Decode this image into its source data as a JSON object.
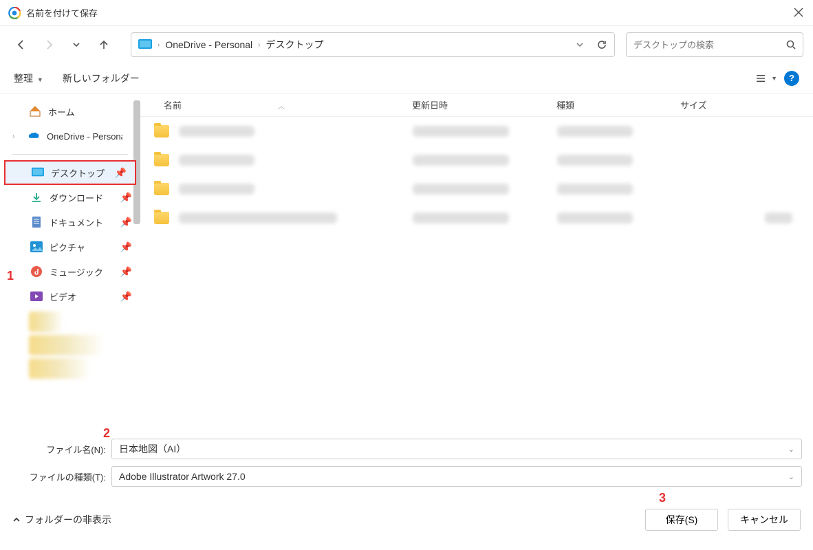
{
  "title": "名前を付けて保存",
  "breadcrumb": {
    "root": "OneDrive - Personal",
    "current": "デスクトップ"
  },
  "search": {
    "placeholder": "デスクトップの検索"
  },
  "toolbar": {
    "organize": "整理",
    "new_folder": "新しいフォルダー"
  },
  "sidebar": {
    "home": "ホーム",
    "onedrive": "OneDrive - Personal",
    "desktop": "デスクトップ",
    "downloads": "ダウンロード",
    "documents": "ドキュメント",
    "pictures": "ピクチャ",
    "music": "ミュージック",
    "videos": "ビデオ"
  },
  "columns": {
    "name": "名前",
    "date": "更新日時",
    "type": "種類",
    "size": "サイズ"
  },
  "filename": {
    "label": "ファイル名(N):",
    "value": "日本地図（AI）"
  },
  "filetype": {
    "label": "ファイルの種類(T):",
    "value": "Adobe Illustrator Artwork 27.0"
  },
  "footer": {
    "hide": "フォルダーの非表示",
    "save": "保存(S)",
    "cancel": "キャンセル"
  },
  "annotations": {
    "a1": "1",
    "a2": "2",
    "a3": "3"
  }
}
